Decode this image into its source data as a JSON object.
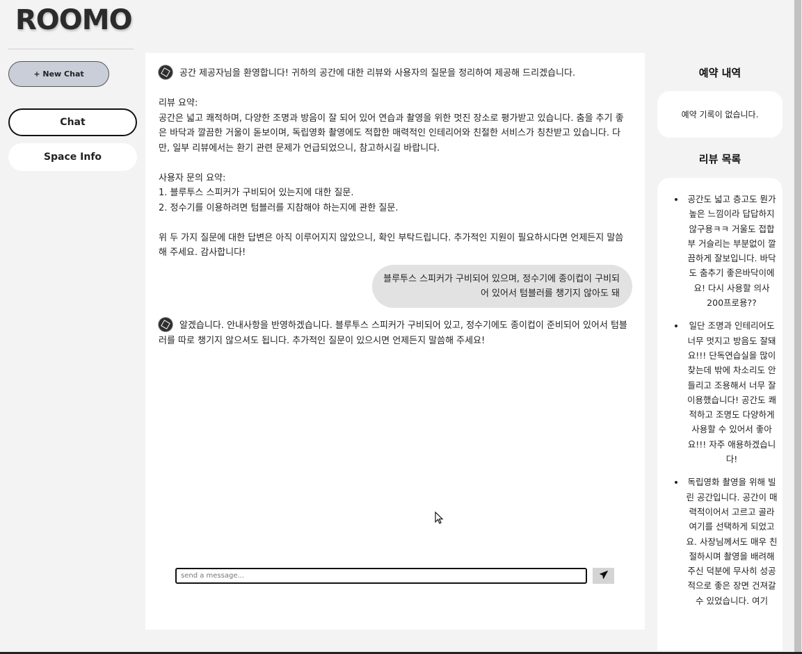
{
  "app": {
    "logo": "ROOMO"
  },
  "sidebar": {
    "new_chat_label": "+ New Chat",
    "nav": [
      {
        "label": "Chat",
        "active": true
      },
      {
        "label": "Space Info",
        "active": false
      }
    ]
  },
  "chat": {
    "bot_message_1": "공간 제공자님을 환영합니다! 귀하의 공간에 대한 리뷰와 사용자의 질문을 정리하여 제공해 드리겠습니다.\n\n리뷰 요약:\n공간은 넓고 쾌적하며, 다양한 조명과 방음이 잘 되어 있어 연습과 촬영을 위한 멋진 장소로 평가받고 있습니다. 춤을 추기 좋은 바닥과 깔끔한 거울이 돋보이며, 독립영화 촬영에도 적합한 매력적인 인테리어와 친절한 서비스가 칭찬받고 있습니다. 다만, 일부 리뷰에서는 환기 관련 문제가 언급되었으니, 참고하시길 바랍니다.\n\n사용자 문의 요약:\n1. 블루투스 스피커가 구비되어 있는지에 대한 질문.\n2. 정수기를 이용하려면 텀블러를 지참해야 하는지에 관한 질문.\n\n위 두 가지 질문에 대한 답변은 아직 이루어지지 않았으니, 확인 부탁드립니다. 추가적인 지원이 필요하시다면 언제든지 말씀해 주세요. 감사합니다!",
    "user_message": "블루투스 스피커가 구비되어 있으며, 정수기에 종이컵이 구비되어 있어서 텀블러를 챙기지 않아도 돼",
    "bot_message_2": "알겠습니다. 안내사항을 반영하겠습니다. 블루투스 스피커가 구비되어 있고, 정수기에도 종이컵이 준비되어 있어서 텀블러를 따로 챙기지 않으셔도 됩니다. 추가적인 질문이 있으시면 언제든지 말씀해 주세요!",
    "input_placeholder": "send a message...",
    "input_value": ""
  },
  "right_panel": {
    "reservations_title": "예약 내역",
    "reservations_empty": "예약 기록이 없습니다.",
    "reviews_title": "리뷰 목록",
    "reviews": [
      "공간도 넓고 층고도 뭔가 높은 느낌이라 답답하지않구용ㅋㅋ 거울도 접합부 거슬리는 부분없이 깔끔하게 잘보입니다. 바닥도 춤추기 좋은바닥이에요! 다시 사용할 의사 200프로용??",
      "일단 조명과 인테리어도 너무 멋지고 방음도 잘돼요!!! 단독연습실을 많이 찾는데 밖에 차소리도 안들리고 조용해서 너무 잘 이용했습니다! 공간도 쾌적하고 조명도 다양하게 사용할 수 있어서 좋아요!!! 자주 애용하겠습니다!",
      "독립영화 촬영을 위해 빌린 공간입니다. 공간이 매력적이어서 고르고 골라 여기를 선택하게 되었고요. 사장님께서도 매우 친절하시며 촬영을 배려해주신 덕분에 무사히 성공적으로 좋은 장면 건져갈 수 있었습니다. 여기"
    ]
  }
}
